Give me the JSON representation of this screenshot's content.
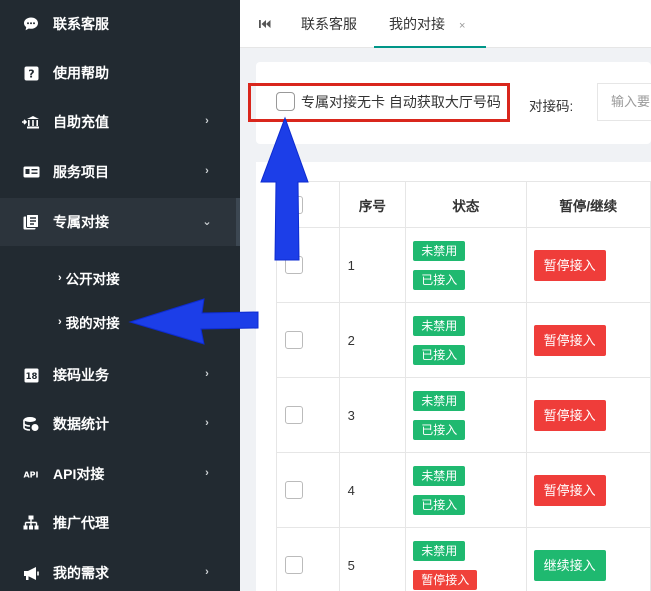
{
  "sidebar": {
    "items": [
      {
        "label": "联系客服",
        "icon": "chat-icon",
        "chevron": ""
      },
      {
        "label": "使用帮助",
        "icon": "help-icon",
        "chevron": ""
      },
      {
        "label": "自助充值",
        "icon": "bank-icon",
        "chevron": "›"
      },
      {
        "label": "服务项目",
        "icon": "card-icon",
        "chevron": "›"
      },
      {
        "label": "专属对接",
        "icon": "dedicated-icon",
        "chevron": "⌄"
      },
      {
        "label": "接码业务",
        "icon": "sms-icon",
        "chevron": "›"
      },
      {
        "label": "数据统计",
        "icon": "database-icon",
        "chevron": "›"
      },
      {
        "label": "API对接",
        "icon": "api-icon",
        "chevron": "›"
      },
      {
        "label": "推广代理",
        "icon": "sitemap-icon",
        "chevron": ""
      },
      {
        "label": "我的需求",
        "icon": "megaphone-icon",
        "chevron": "›"
      }
    ],
    "sub_items": [
      {
        "label": "公开对接",
        "arrow": "›"
      },
      {
        "label": "我的对接",
        "arrow": "›"
      }
    ]
  },
  "tabs": {
    "items": [
      {
        "label": "联系客服"
      },
      {
        "label": "我的对接",
        "close": "×"
      }
    ]
  },
  "filter": {
    "checkbox_label": "专属对接无卡 自动获取大厅号码",
    "code_label": "对接码:",
    "code_placeholder": "输入要"
  },
  "table": {
    "headers": [
      "",
      "序号",
      "状态",
      "暂停/继续"
    ],
    "rows": [
      {
        "no": "1",
        "status": [
          {
            "text": "未禁用",
            "color": "green"
          },
          {
            "text": "已接入",
            "color": "green"
          }
        ],
        "action": {
          "text": "暂停接入",
          "color": "red"
        }
      },
      {
        "no": "2",
        "status": [
          {
            "text": "未禁用",
            "color": "green"
          },
          {
            "text": "已接入",
            "color": "green"
          }
        ],
        "action": {
          "text": "暂停接入",
          "color": "red"
        }
      },
      {
        "no": "3",
        "status": [
          {
            "text": "未禁用",
            "color": "green"
          },
          {
            "text": "已接入",
            "color": "green"
          }
        ],
        "action": {
          "text": "暂停接入",
          "color": "red"
        }
      },
      {
        "no": "4",
        "status": [
          {
            "text": "未禁用",
            "color": "green"
          },
          {
            "text": "已接入",
            "color": "green"
          }
        ],
        "action": {
          "text": "暂停接入",
          "color": "red"
        }
      },
      {
        "no": "5",
        "status": [
          {
            "text": "未禁用",
            "color": "green"
          },
          {
            "text": "暂停接入",
            "color": "red"
          }
        ],
        "action": {
          "text": "继续接入",
          "color": "green"
        }
      }
    ]
  },
  "colors": {
    "sidebar_bg": "#222a31",
    "accent_green": "#1fb970",
    "accent_red": "#ef3d3a",
    "annotation_blue": "#1c3ee8",
    "highlight_red": "#d9261c"
  }
}
